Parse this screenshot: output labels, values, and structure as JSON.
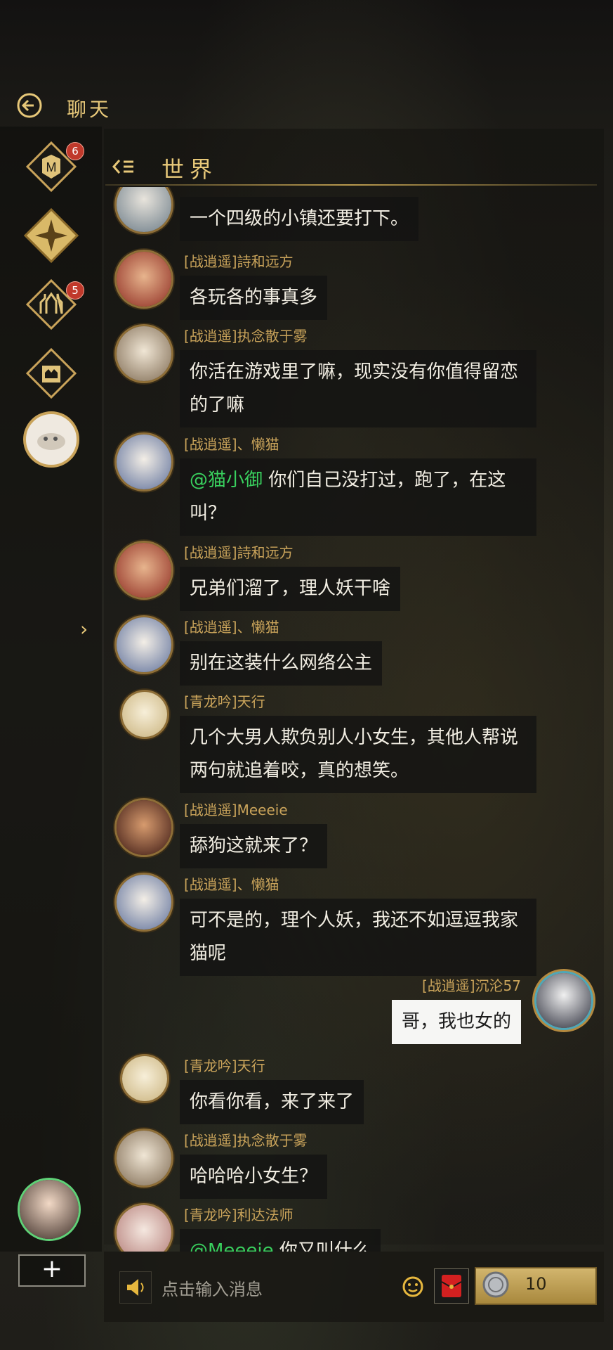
{
  "header": {
    "title": "聊天"
  },
  "channel": {
    "title": "世界"
  },
  "sidebar": {
    "buttons": [
      {
        "name": "guild-emblem-icon",
        "badge": "6"
      },
      {
        "name": "compass-icon",
        "badge": ""
      },
      {
        "name": "castle-icon",
        "badge": "5"
      },
      {
        "name": "crown-icon",
        "badge": ""
      }
    ]
  },
  "messages": [
    {
      "sender": "[战逍遥]詩和远方",
      "text": "各玩各的事真多"
    },
    {
      "sender": "[战逍遥]执念散于雾",
      "text": "你活在游戏里了嘛，现实没有你值得留恋的了嘛"
    },
    {
      "sender": "[战逍遥]、懒猫",
      "mention": "@猫小御",
      "text": " 你们自己没打过，跑了，在这叫？"
    },
    {
      "sender": "[战逍遥]詩和远方",
      "text": "兄弟们溜了，理人妖干啥"
    },
    {
      "sender": "[战逍遥]、懒猫",
      "text": "别在这装什么网络公主"
    },
    {
      "sender": "[青龙吟]天行",
      "text": "几个大男人欺负别人小女生，其他人帮说两句就追着咬，真的想笑。"
    },
    {
      "sender": "[战逍遥]Meeeie",
      "text": "舔狗这就来了？"
    },
    {
      "sender": "[战逍遥]、懒猫",
      "text": "可不是的，理个人妖，我还不如逗逗我家猫呢"
    },
    {
      "sender": "[战逍遥]沉沦57",
      "text": "哥，我也女的"
    },
    {
      "sender": "[青龙吟]天行",
      "text": "你看你看，来了来了"
    },
    {
      "sender": "[战逍遥]执念散于雾",
      "text": "哈哈哈小女生？"
    },
    {
      "sender": "[青龙吟]利达法师",
      "mention": "@Meeeie",
      "text": " 你又叫什么"
    }
  ],
  "first_partial": {
    "text": "一个四级的小镇还要打下。"
  },
  "input": {
    "placeholder": "点击输入消息"
  },
  "currency": {
    "count": "10"
  },
  "plus_label": "+"
}
